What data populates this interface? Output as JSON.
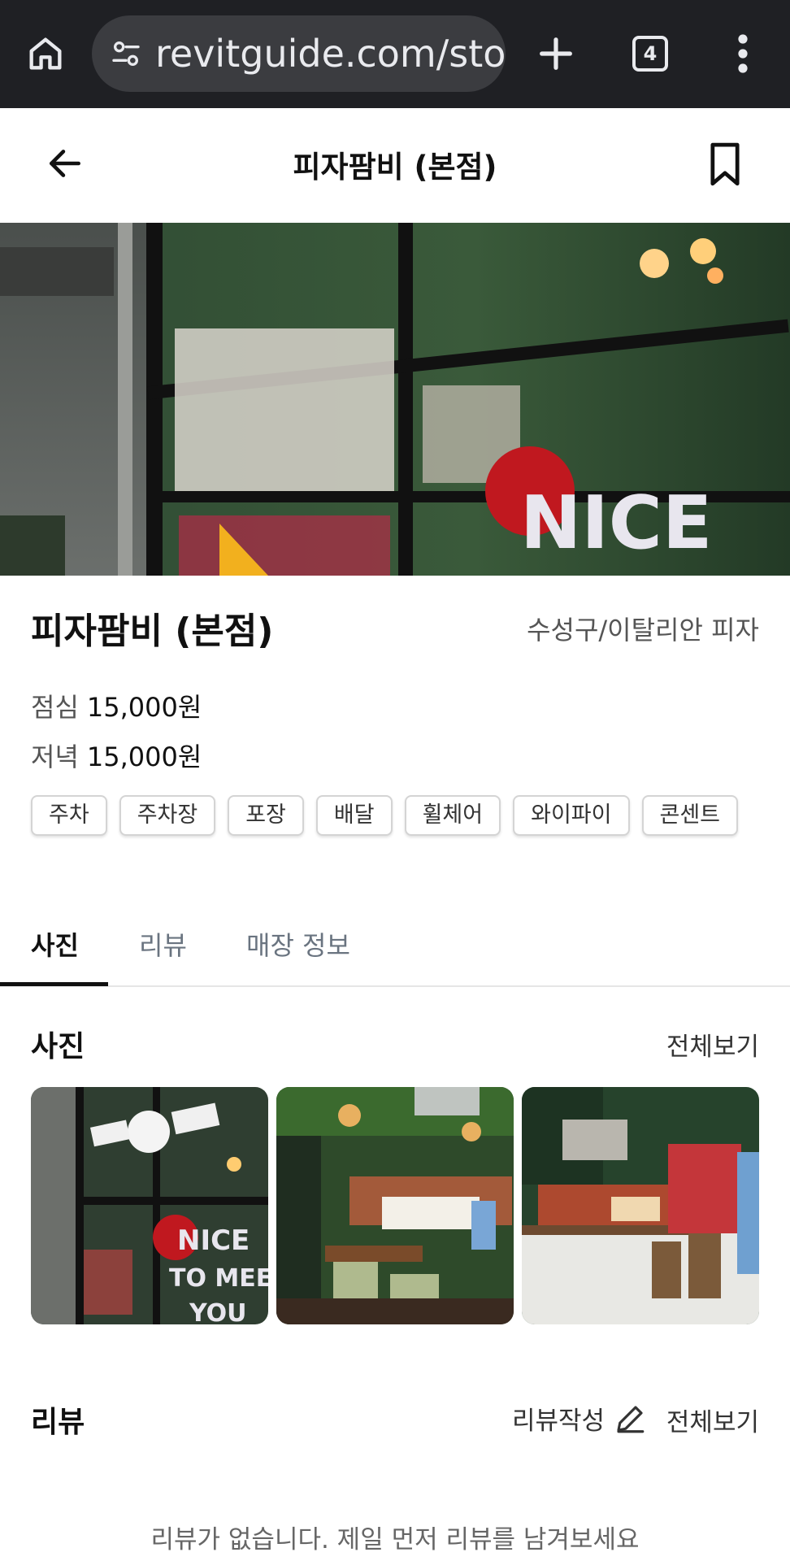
{
  "browser": {
    "url": "revitguide.com/stor",
    "tab_count": "4",
    "icons": [
      "home-icon",
      "site-settings-icon",
      "new-tab-icon",
      "tab-switcher-icon",
      "more-vert-icon"
    ]
  },
  "header": {
    "title": "피자팜비 (본점)"
  },
  "store": {
    "name": "피자팜비 (본점)",
    "category": "수성구/이탈리안 피자",
    "prices": [
      {
        "label": "점심",
        "amount": "15,000원"
      },
      {
        "label": "저녁",
        "amount": "15,000원"
      }
    ],
    "tags": [
      "주차",
      "주차장",
      "포장",
      "배달",
      "휠체어",
      "와이파이",
      "콘센트"
    ]
  },
  "tabs": [
    {
      "label": "사진",
      "active": true
    },
    {
      "label": "리뷰",
      "active": false
    },
    {
      "label": "매장 정보",
      "active": false
    }
  ],
  "photos": {
    "title": "사진",
    "see_all": "전체보기"
  },
  "reviews": {
    "title": "리뷰",
    "write": "리뷰작성",
    "see_all": "전체보기",
    "empty": "리뷰가 없습니다. 제일 먼저 리뷰를 남겨보세요"
  },
  "colors": {
    "browser_bg": "#1f2024",
    "url_pill": "#3b3c40",
    "tab_inactive": "#6a7480"
  }
}
